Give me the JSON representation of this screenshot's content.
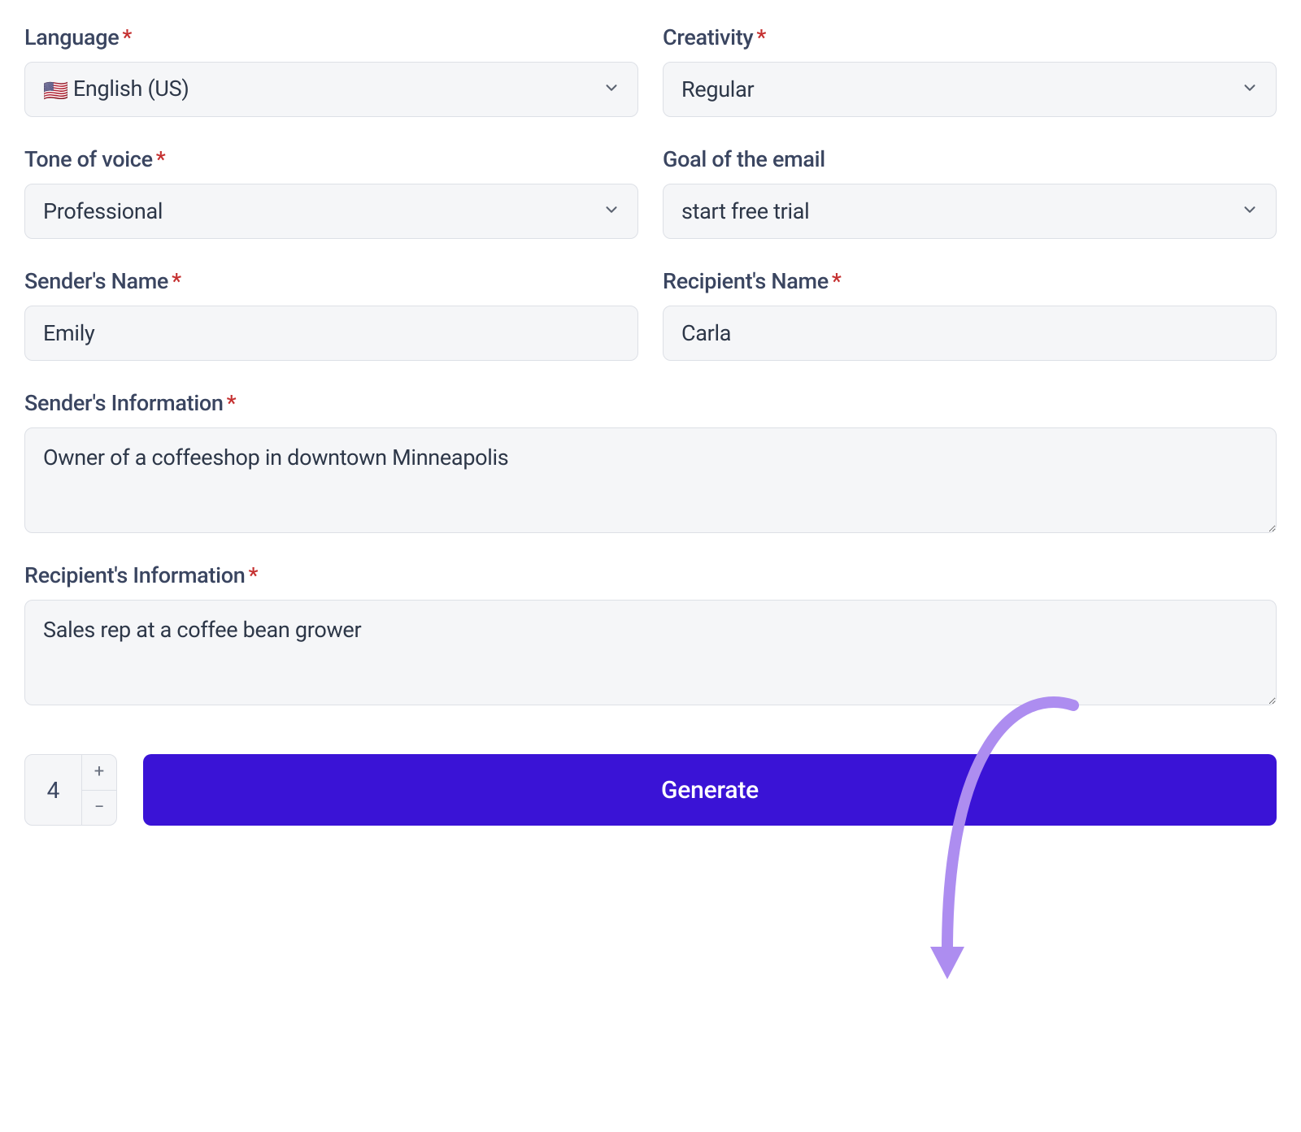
{
  "fields": {
    "language": {
      "label": "Language",
      "required": true,
      "value": "English (US)",
      "flag": "🇺🇸"
    },
    "creativity": {
      "label": "Creativity",
      "required": true,
      "value": "Regular"
    },
    "tone": {
      "label": "Tone of voice",
      "required": true,
      "value": "Professional"
    },
    "goal": {
      "label": "Goal of the email",
      "required": false,
      "value": "start free trial"
    },
    "sender_name": {
      "label": "Sender's Name",
      "required": true,
      "value": "Emily"
    },
    "recipient_name": {
      "label": "Recipient's Name",
      "required": true,
      "value": "Carla"
    },
    "sender_info": {
      "label": "Sender's Information",
      "required": true,
      "value": "Owner of a coffeeshop in downtown Minneapolis"
    },
    "recipient_info": {
      "label": "Recipient's Information",
      "required": true,
      "value": "Sales rep at a coffee bean grower"
    }
  },
  "stepper": {
    "value": "4",
    "plus": "+",
    "minus": "−"
  },
  "generate_label": "Generate",
  "required_marker": "*"
}
